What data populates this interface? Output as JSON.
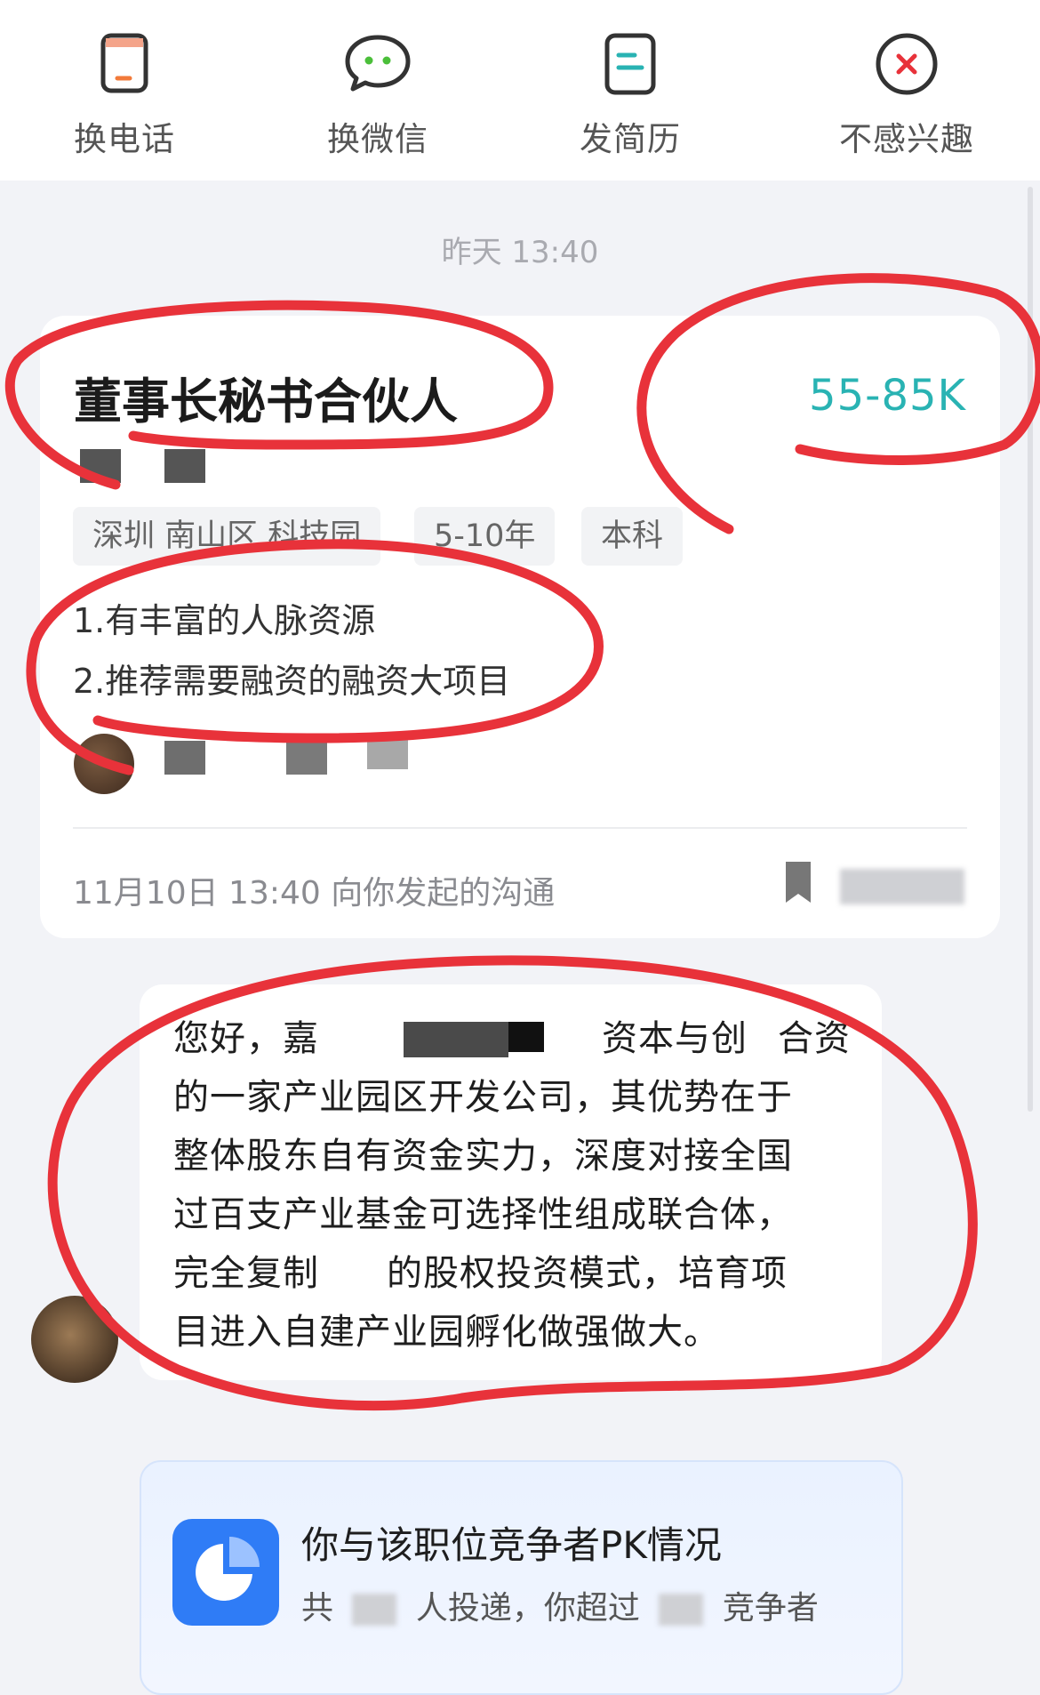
{
  "actions": [
    {
      "label": "换电话",
      "icon": "phone-icon"
    },
    {
      "label": "换微信",
      "icon": "wechat-icon"
    },
    {
      "label": "发简历",
      "icon": "resume-icon"
    },
    {
      "label": "不感兴趣",
      "icon": "close-circle-icon"
    }
  ],
  "chat": {
    "timestamp": "昨天 13:40"
  },
  "job": {
    "title": "董事长秘书合伙人",
    "salary": "55-85K",
    "tags": [
      "深圳 南山区 科技园",
      "5-10年",
      "本科"
    ],
    "description": [
      "1.有丰富的人脉资源",
      "2.推荐需要融资的融资大项目"
    ],
    "contact_note": "11月10日 13:40 向你发起的沟通"
  },
  "message": {
    "lines": [
      "您好，嘉",
      "的一家产业园区开发公司，其优势在于",
      "整体股东自有资金实力，深度对接全国",
      "过百支产业基金可选择性组成联合体，",
      "完全复制",
      "目进入自建产业园孵化做强做大。"
    ],
    "line1_tail": "资本与创",
    "line1_end": "合资",
    "line5_tail": "的股权投资模式，培育项"
  },
  "pk": {
    "title": "你与该职位竞争者PK情况",
    "sub_prefix": "共",
    "sub_middle": "人投递，你超过",
    "sub_suffix": "竞争者"
  },
  "colors": {
    "salary": "#29b3b3",
    "annotation": "#e8323a",
    "pk_icon": "#2f7cf6"
  }
}
